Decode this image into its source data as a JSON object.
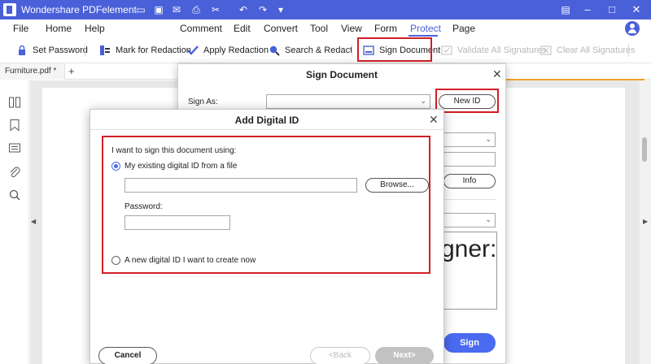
{
  "app": {
    "title": "Wondershare PDFelement"
  },
  "menu": {
    "items": [
      "File",
      "Home",
      "Help",
      "Comment",
      "Edit",
      "Convert",
      "Tool",
      "View",
      "Form",
      "Protect",
      "Page"
    ]
  },
  "toolbar": {
    "set_password": "Set Password",
    "mark_for_redaction": "Mark for Redaction",
    "apply_redaction": "Apply Redaction",
    "search_redact": "Search & Redact",
    "sign_document": "Sign Document",
    "validate_all": "Validate All Signatures",
    "clear_all": "Clear All Signatures"
  },
  "tab": {
    "name": "Furniture.pdf *"
  },
  "sign_dialog": {
    "title": "Sign Document",
    "sign_as_label": "Sign As:",
    "new_id_button": "New ID",
    "info_button": "Info",
    "preview_text": "gner:",
    "sign_button": "Sign"
  },
  "add_dialog": {
    "title": "Add Digital ID",
    "prompt": "I want to sign this document using:",
    "option_existing": "My existing digital ID from a file",
    "browse_button": "Browse...",
    "password_label": "Password:",
    "option_new": "A new digital ID I want to create now",
    "cancel_button": "Cancel",
    "back_button": "<Back",
    "next_button": "Next>"
  },
  "colors": {
    "accent": "#4a60d8",
    "highlight_red": "#d21f26",
    "sign_button": "#4a6af0"
  }
}
